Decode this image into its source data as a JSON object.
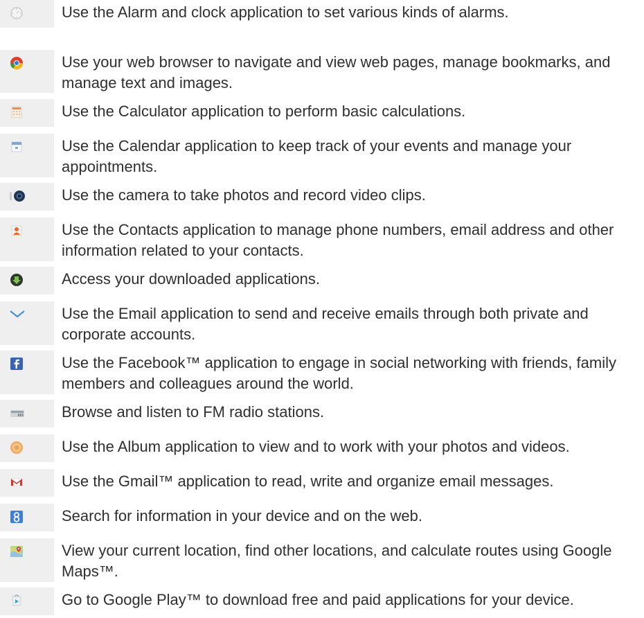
{
  "apps": [
    {
      "icon": "alarm-clock-icon",
      "description": "Use the Alarm and clock application to set various kinds of alarms."
    },
    {
      "icon": "browser-icon",
      "description": "Use your web browser to navigate and view web pages, manage bookmarks, and manage text and images."
    },
    {
      "icon": "calculator-icon",
      "description": "Use the Calculator application to perform basic calculations."
    },
    {
      "icon": "calendar-icon",
      "description": "Use the Calendar application to keep track of your events and manage your appointments."
    },
    {
      "icon": "camera-icon",
      "description": "Use the camera to take photos and record video clips."
    },
    {
      "icon": "contacts-icon",
      "description": "Use the Contacts application to manage phone numbers, email address and other information related to your contacts."
    },
    {
      "icon": "downloads-icon",
      "description": "Access your downloaded applications."
    },
    {
      "icon": "email-icon",
      "description": "Use the Email application to send and receive emails through both private and corporate accounts."
    },
    {
      "icon": "facebook-icon",
      "description": "Use the Facebook™ application to engage in social networking with friends, family members and colleagues around the world."
    },
    {
      "icon": "fm-radio-icon",
      "description": "Browse and listen to FM radio stations."
    },
    {
      "icon": "album-icon",
      "description": "Use the Album application to view and to work with your photos and videos."
    },
    {
      "icon": "gmail-icon",
      "description": "Use the Gmail™ application to read, write and organize email messages."
    },
    {
      "icon": "google-search-icon",
      "description": "Search for information in your device and on the web."
    },
    {
      "icon": "maps-icon",
      "description": "View your current location, find other locations, and calculate routes using Google Maps™."
    },
    {
      "icon": "google-play-icon",
      "description": "Go to Google Play™ to download free and paid applications for your device."
    }
  ]
}
